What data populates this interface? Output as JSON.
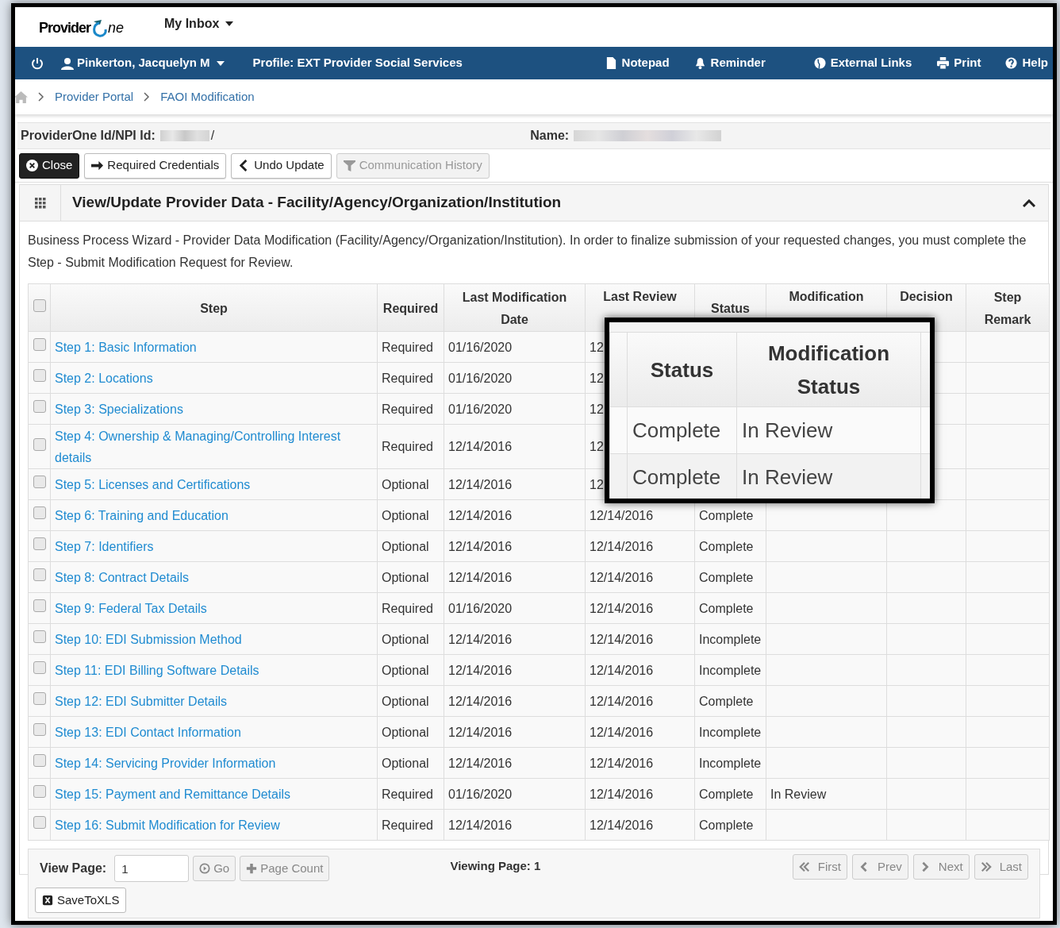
{
  "logo": {
    "text_1": "Provider",
    "text_2": "ne"
  },
  "inbox_menu": "My Inbox",
  "nav": {
    "user": "Pinkerton, Jacquelyn M",
    "profile": "Profile: EXT Provider Social Services",
    "links": [
      {
        "kind": "notepad",
        "label": "Notepad"
      },
      {
        "kind": "reminder",
        "label": "Reminder"
      },
      {
        "kind": "globe",
        "label": "External Links"
      },
      {
        "kind": "print",
        "label": "Print"
      },
      {
        "kind": "help",
        "label": "Help"
      }
    ]
  },
  "breadcrumb": [
    "Provider Portal",
    "FAOI Modification"
  ],
  "id_bar": {
    "id_label": "ProviderOne Id/NPI Id:",
    "id_suffix": "/",
    "name_label": "Name:"
  },
  "actions": [
    {
      "kind": "close",
      "label": "Close",
      "disabled": false
    },
    {
      "kind": "arrow",
      "label": "Required Credentials",
      "disabled": false
    },
    {
      "kind": "back",
      "label": "Undo Update",
      "disabled": false
    },
    {
      "kind": "filter",
      "label": "Communication History",
      "disabled": true
    }
  ],
  "panel": {
    "title": "View/Update Provider Data - Facility/Agency/Organization/Institution",
    "expanded": true,
    "description": "Business Process Wizard - Provider Data Modification (Facility/Agency/Organization/Institution). In order to finalize submission of your requested changes, you must complete the Step - Submit Modification Request for Review."
  },
  "table": {
    "all_checked": false,
    "columns": [
      "Step",
      "Required",
      "Last Modification Date",
      "Last Review",
      "Status",
      "Modification",
      "Decision",
      "Step Remark"
    ],
    "rows": [
      {
        "checked": false,
        "step": "Step 1: Basic Information",
        "required": "Required",
        "last_modified": "01/16/2020",
        "last_review": "12"
      },
      {
        "checked": false,
        "step": "Step 2: Locations",
        "required": "Required",
        "last_modified": "01/16/2020",
        "last_review": "12"
      },
      {
        "checked": false,
        "step": "Step 3: Specializations",
        "required": "Required",
        "last_modified": "01/16/2020",
        "last_review": "12"
      },
      {
        "checked": false,
        "step": "Step 4: Ownership & Managing/Controlling Interest details",
        "required": "Required",
        "last_modified": "12/14/2016",
        "last_review": "12"
      },
      {
        "checked": false,
        "step": "Step 5: Licenses and Certifications",
        "required": "Optional",
        "last_modified": "12/14/2016",
        "last_review": "12"
      },
      {
        "checked": false,
        "step": "Step 6: Training and Education",
        "required": "Optional",
        "last_modified": "12/14/2016",
        "last_review": "12/14/2016",
        "status": "Complete"
      },
      {
        "checked": false,
        "step": "Step 7: Identifiers",
        "required": "Optional",
        "last_modified": "12/14/2016",
        "last_review": "12/14/2016",
        "status": "Complete"
      },
      {
        "checked": false,
        "step": "Step 8: Contract Details",
        "required": "Optional",
        "last_modified": "12/14/2016",
        "last_review": "12/14/2016",
        "status": "Complete"
      },
      {
        "checked": false,
        "step": "Step 9: Federal Tax Details",
        "required": "Required",
        "last_modified": "01/16/2020",
        "last_review": "12/14/2016",
        "status": "Complete"
      },
      {
        "checked": false,
        "step": "Step 10: EDI Submission Method",
        "required": "Optional",
        "last_modified": "12/14/2016",
        "last_review": "12/14/2016",
        "status": "Incomplete"
      },
      {
        "checked": false,
        "step": "Step 11: EDI Billing Software Details",
        "required": "Optional",
        "last_modified": "12/14/2016",
        "last_review": "12/14/2016",
        "status": "Incomplete"
      },
      {
        "checked": false,
        "step": "Step 12: EDI Submitter Details",
        "required": "Optional",
        "last_modified": "12/14/2016",
        "last_review": "12/14/2016",
        "status": "Complete"
      },
      {
        "checked": false,
        "step": "Step 13: EDI Contact Information",
        "required": "Optional",
        "last_modified": "12/14/2016",
        "last_review": "12/14/2016",
        "status": "Incomplete"
      },
      {
        "checked": false,
        "step": "Step 14: Servicing Provider Information",
        "required": "Optional",
        "last_modified": "12/14/2016",
        "last_review": "12/14/2016",
        "status": "Incomplete"
      },
      {
        "checked": false,
        "step": "Step 15: Payment and Remittance Details",
        "required": "Required",
        "last_modified": "01/16/2020",
        "last_review": "12/14/2016",
        "status": "Complete",
        "modification": "In Review"
      },
      {
        "checked": false,
        "step": "Step 16: Submit Modification for Review",
        "required": "Required",
        "last_modified": "12/14/2016",
        "last_review": "12/14/2016",
        "status": "Complete"
      }
    ]
  },
  "callout": {
    "columns": [
      "Status",
      "Modification Status"
    ],
    "rows": [
      [
        "Complete",
        "In Review"
      ],
      [
        "Complete",
        "In Review"
      ]
    ]
  },
  "footer": {
    "view_page_label": "View Page:",
    "page_value": "1",
    "go": "Go",
    "page_count": "Page Count",
    "viewing": "Viewing Page: 1",
    "pager": [
      {
        "kind": "first",
        "label": "First"
      },
      {
        "kind": "prev",
        "label": "Prev"
      },
      {
        "kind": "next",
        "label": "Next"
      },
      {
        "kind": "last",
        "label": "Last"
      }
    ],
    "export": "SaveToXLS"
  }
}
